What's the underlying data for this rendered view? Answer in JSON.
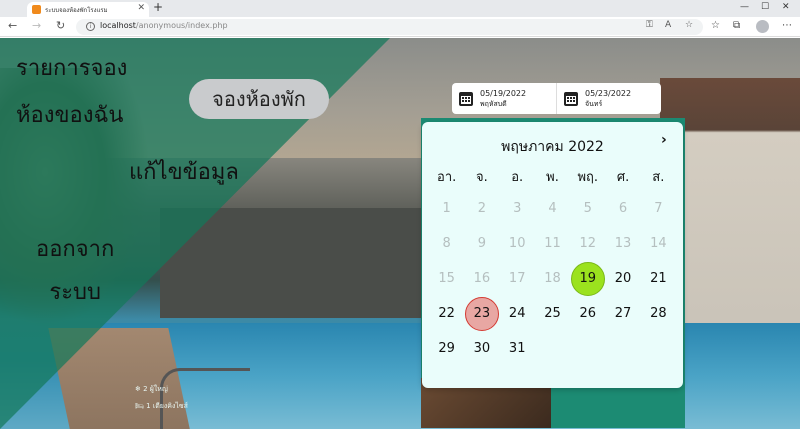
{
  "browser": {
    "tab_title": "ระบบจองห้องพักโรงแรม",
    "url_host": "localhost",
    "url_path": "/anonymous/index.php"
  },
  "menu": {
    "my_bookings_line1": "รายการจอง",
    "my_bookings_line2": "ห้องของฉัน",
    "book_room": "จองห้องพัก",
    "edit_info": "แก้ไขข้อมูล",
    "logout_line1": "ออกจาก",
    "logout_line2": "ระบบ"
  },
  "date_range": {
    "checkin_date": "05/19/2022",
    "checkin_day": "พฤหัสบดี",
    "checkout_date": "05/23/2022",
    "checkout_day": "จันทร์"
  },
  "calendar": {
    "title": "พฤษภาคม 2022",
    "next_icon": "chevron-right-icon",
    "weekdays": [
      "อา.",
      "จ.",
      "อ.",
      "พ.",
      "พฤ.",
      "ศ.",
      "ส."
    ],
    "first_weekday_offset": 0,
    "days_in_month": 31,
    "past_through": 18,
    "selected_start": 19,
    "selected_end": 23,
    "colors": {
      "start": "#9be21e",
      "end_fill": "#e8a7a3",
      "end_border": "#d43a32",
      "past": "#b5bfbf"
    }
  },
  "card": {
    "info_line1": "2 ผู้ใหญ่",
    "info_line2": "1 เตียงคิงไซส์"
  },
  "colors": {
    "overlay_green": "#14785a",
    "calendar_bg": "#eafdfb"
  }
}
